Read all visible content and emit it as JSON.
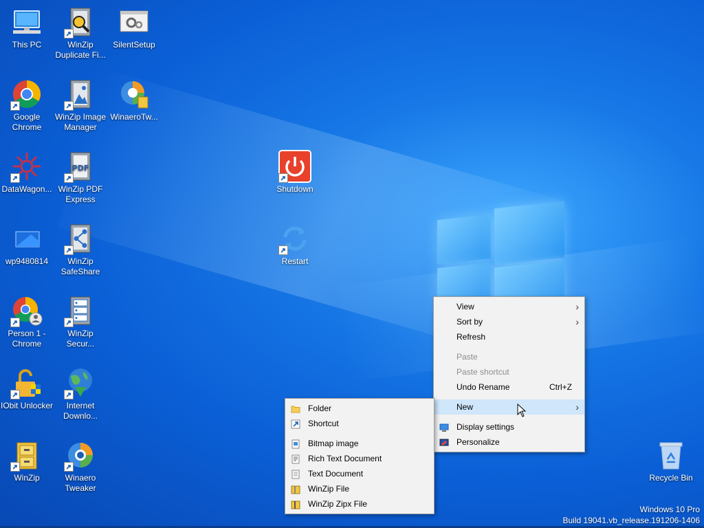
{
  "desktop": {
    "icons": [
      {
        "label": "This PC"
      },
      {
        "label": "WinZip Duplicate Fi..."
      },
      {
        "label": "SilentSetup"
      },
      {
        "label": "Google Chrome"
      },
      {
        "label": "WinZip Image Manager"
      },
      {
        "label": "WinaeroTw..."
      },
      {
        "label": "DataWagon..."
      },
      {
        "label": "WinZip PDF Express"
      },
      {
        "label": "Shutdown"
      },
      {
        "label": "wp9480814"
      },
      {
        "label": "WinZip SafeShare"
      },
      {
        "label": "Restart"
      },
      {
        "label": "Person 1 - Chrome"
      },
      {
        "label": "WinZip Secur..."
      },
      {
        "label": "IObit Unlocker"
      },
      {
        "label": "Internet Downlo..."
      },
      {
        "label": "WinZip"
      },
      {
        "label": "Winaero Tweaker"
      },
      {
        "label": "Recycle Bin"
      }
    ]
  },
  "context_menu": {
    "items": [
      {
        "label": "View"
      },
      {
        "label": "Sort by"
      },
      {
        "label": "Refresh"
      },
      {
        "label": "Paste"
      },
      {
        "label": "Paste shortcut"
      },
      {
        "label": "Undo Rename",
        "shortcut": "Ctrl+Z"
      },
      {
        "label": "New"
      },
      {
        "label": "Display settings"
      },
      {
        "label": "Personalize"
      }
    ]
  },
  "new_submenu": {
    "items": [
      {
        "label": "Folder"
      },
      {
        "label": "Shortcut"
      },
      {
        "label": "Bitmap image"
      },
      {
        "label": "Rich Text Document"
      },
      {
        "label": "Text Document"
      },
      {
        "label": "WinZip File"
      },
      {
        "label": "WinZip Zipx File"
      }
    ]
  },
  "watermark": {
    "edition": "Windows 10 Pro",
    "build": "Build 19041.vb_release.191206-1406"
  },
  "colors": {
    "desktop_blue": "#0b5fd6",
    "menu_bg": "#f2f2f2",
    "menu_highlight": "#cfe6fb",
    "shutdown_red": "#e8412c"
  }
}
